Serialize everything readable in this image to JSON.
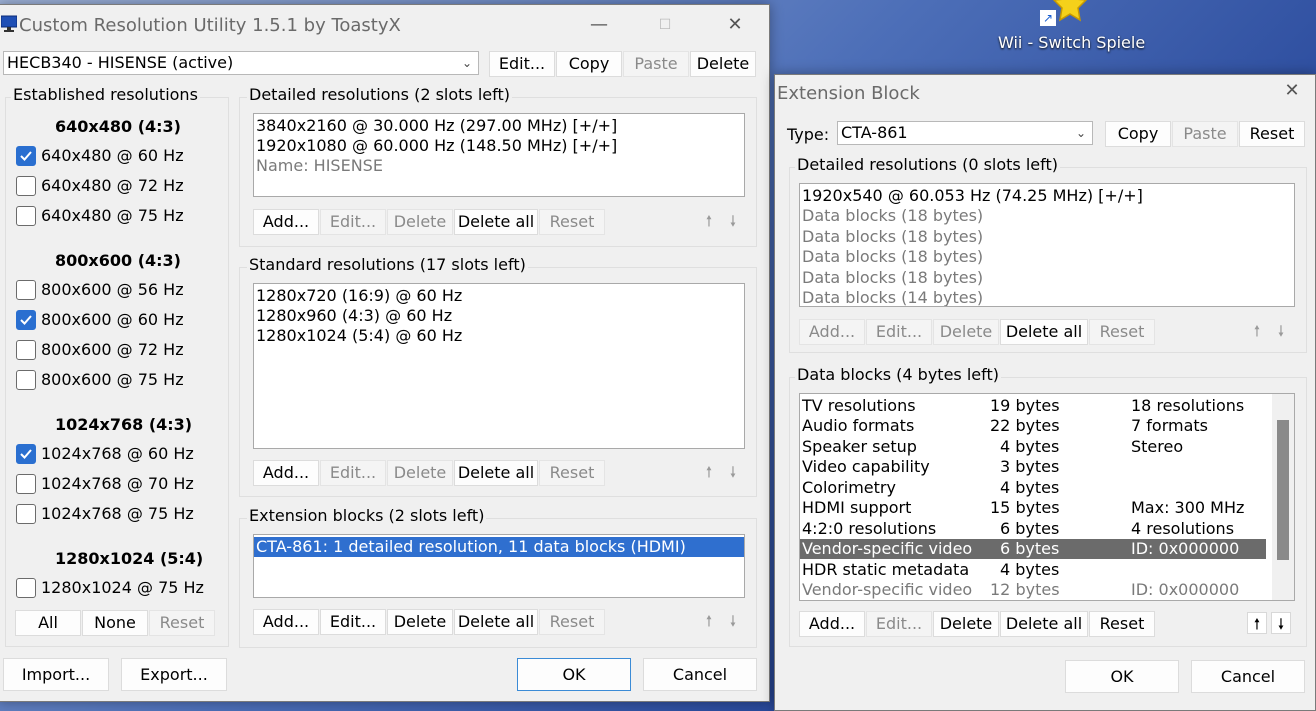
{
  "desktop": {
    "icon_label": "Wii - Switch Spiele"
  },
  "main": {
    "title": "Custom Resolution Utility 1.5.1 by ToastyX",
    "display_select": "HECB340 - HISENSE (active)",
    "top_buttons": {
      "edit": "Edit...",
      "copy": "Copy",
      "paste": "Paste",
      "delete": "Delete"
    },
    "established": {
      "label": "Established resolutions",
      "groups": [
        {
          "header": "640x480 (4:3)",
          "items": [
            {
              "label": "640x480 @ 60 Hz",
              "checked": true
            },
            {
              "label": "640x480 @ 72 Hz",
              "checked": false
            },
            {
              "label": "640x480 @ 75 Hz",
              "checked": false
            }
          ]
        },
        {
          "header": "800x600 (4:3)",
          "items": [
            {
              "label": "800x600 @ 56 Hz",
              "checked": false
            },
            {
              "label": "800x600 @ 60 Hz",
              "checked": true
            },
            {
              "label": "800x600 @ 72 Hz",
              "checked": false
            },
            {
              "label": "800x600 @ 75 Hz",
              "checked": false
            }
          ]
        },
        {
          "header": "1024x768 (4:3)",
          "items": [
            {
              "label": "1024x768 @ 60 Hz",
              "checked": true
            },
            {
              "label": "1024x768 @ 70 Hz",
              "checked": false
            },
            {
              "label": "1024x768 @ 75 Hz",
              "checked": false
            }
          ]
        },
        {
          "header": "1280x1024 (5:4)",
          "items": [
            {
              "label": "1280x1024 @ 75 Hz",
              "checked": false
            }
          ]
        }
      ],
      "buttons": {
        "all": "All",
        "none": "None",
        "reset": "Reset"
      }
    },
    "detailed": {
      "label": "Detailed resolutions (2 slots left)",
      "rows": [
        "3840x2160 @ 30.000 Hz (297.00 MHz) [+/+]",
        "1920x1080 @ 60.000 Hz (148.50 MHz) [+/+]",
        "Name: HISENSE"
      ]
    },
    "standard": {
      "label": "Standard resolutions (17 slots left)",
      "rows": [
        "1280x720 (16:9) @ 60 Hz",
        "1280x960 (4:3) @ 60 Hz",
        "1280x1024 (5:4) @ 60 Hz"
      ]
    },
    "extension": {
      "label": "Extension blocks (2 slots left)",
      "rows": [
        "CTA-861: 1 detailed resolution, 11 data blocks (HDMI)"
      ]
    },
    "row_buttons": {
      "add": "Add...",
      "edit": "Edit...",
      "delete": "Delete",
      "delete_all": "Delete all",
      "reset": "Reset"
    },
    "arrows": {
      "up": "🠕",
      "down": "🠗"
    },
    "bottom": {
      "import": "Import...",
      "export": "Export...",
      "ok": "OK",
      "cancel": "Cancel"
    }
  },
  "ext": {
    "title": "Extension Block",
    "type_label": "Type:",
    "type_value": "CTA-861",
    "top_buttons": {
      "copy": "Copy",
      "paste": "Paste",
      "reset": "Reset"
    },
    "detailed": {
      "label": "Detailed resolutions (0 slots left)",
      "rows": [
        "1920x540 @ 60.053 Hz (74.25 MHz) [+/+]",
        "Data blocks (18 bytes)",
        "Data blocks (18 bytes)",
        "Data blocks (18 bytes)",
        "Data blocks (18 bytes)",
        "Data blocks (14 bytes)"
      ]
    },
    "datablocks": {
      "label": "Data blocks (4 bytes left)",
      "rows": [
        {
          "name": "TV resolutions",
          "size": "19 bytes",
          "info": "18 resolutions"
        },
        {
          "name": "Audio formats",
          "size": "22 bytes",
          "info": "7 formats"
        },
        {
          "name": "Speaker setup",
          "size": "4 bytes",
          "info": "Stereo"
        },
        {
          "name": "Video capability",
          "size": "3 bytes",
          "info": ""
        },
        {
          "name": "Colorimetry",
          "size": "4 bytes",
          "info": ""
        },
        {
          "name": "HDMI support",
          "size": "15 bytes",
          "info": "Max: 300 MHz"
        },
        {
          "name": "4:2:0 resolutions",
          "size": "6 bytes",
          "info": "4 resolutions"
        },
        {
          "name": "Vendor-specific video",
          "size": "6 bytes",
          "info": "ID: 0x000000"
        },
        {
          "name": "HDR static metadata",
          "size": "4 bytes",
          "info": ""
        },
        {
          "name": "Vendor-specific video",
          "size": "12 bytes",
          "info": "ID: 0x000000"
        }
      ]
    },
    "row_buttons": {
      "add": "Add...",
      "edit": "Edit...",
      "delete": "Delete",
      "delete_all": "Delete all",
      "reset": "Reset"
    },
    "arrows": {
      "up": "🠕",
      "down": "🠗"
    },
    "bottom": {
      "ok": "OK",
      "cancel": "Cancel"
    }
  }
}
